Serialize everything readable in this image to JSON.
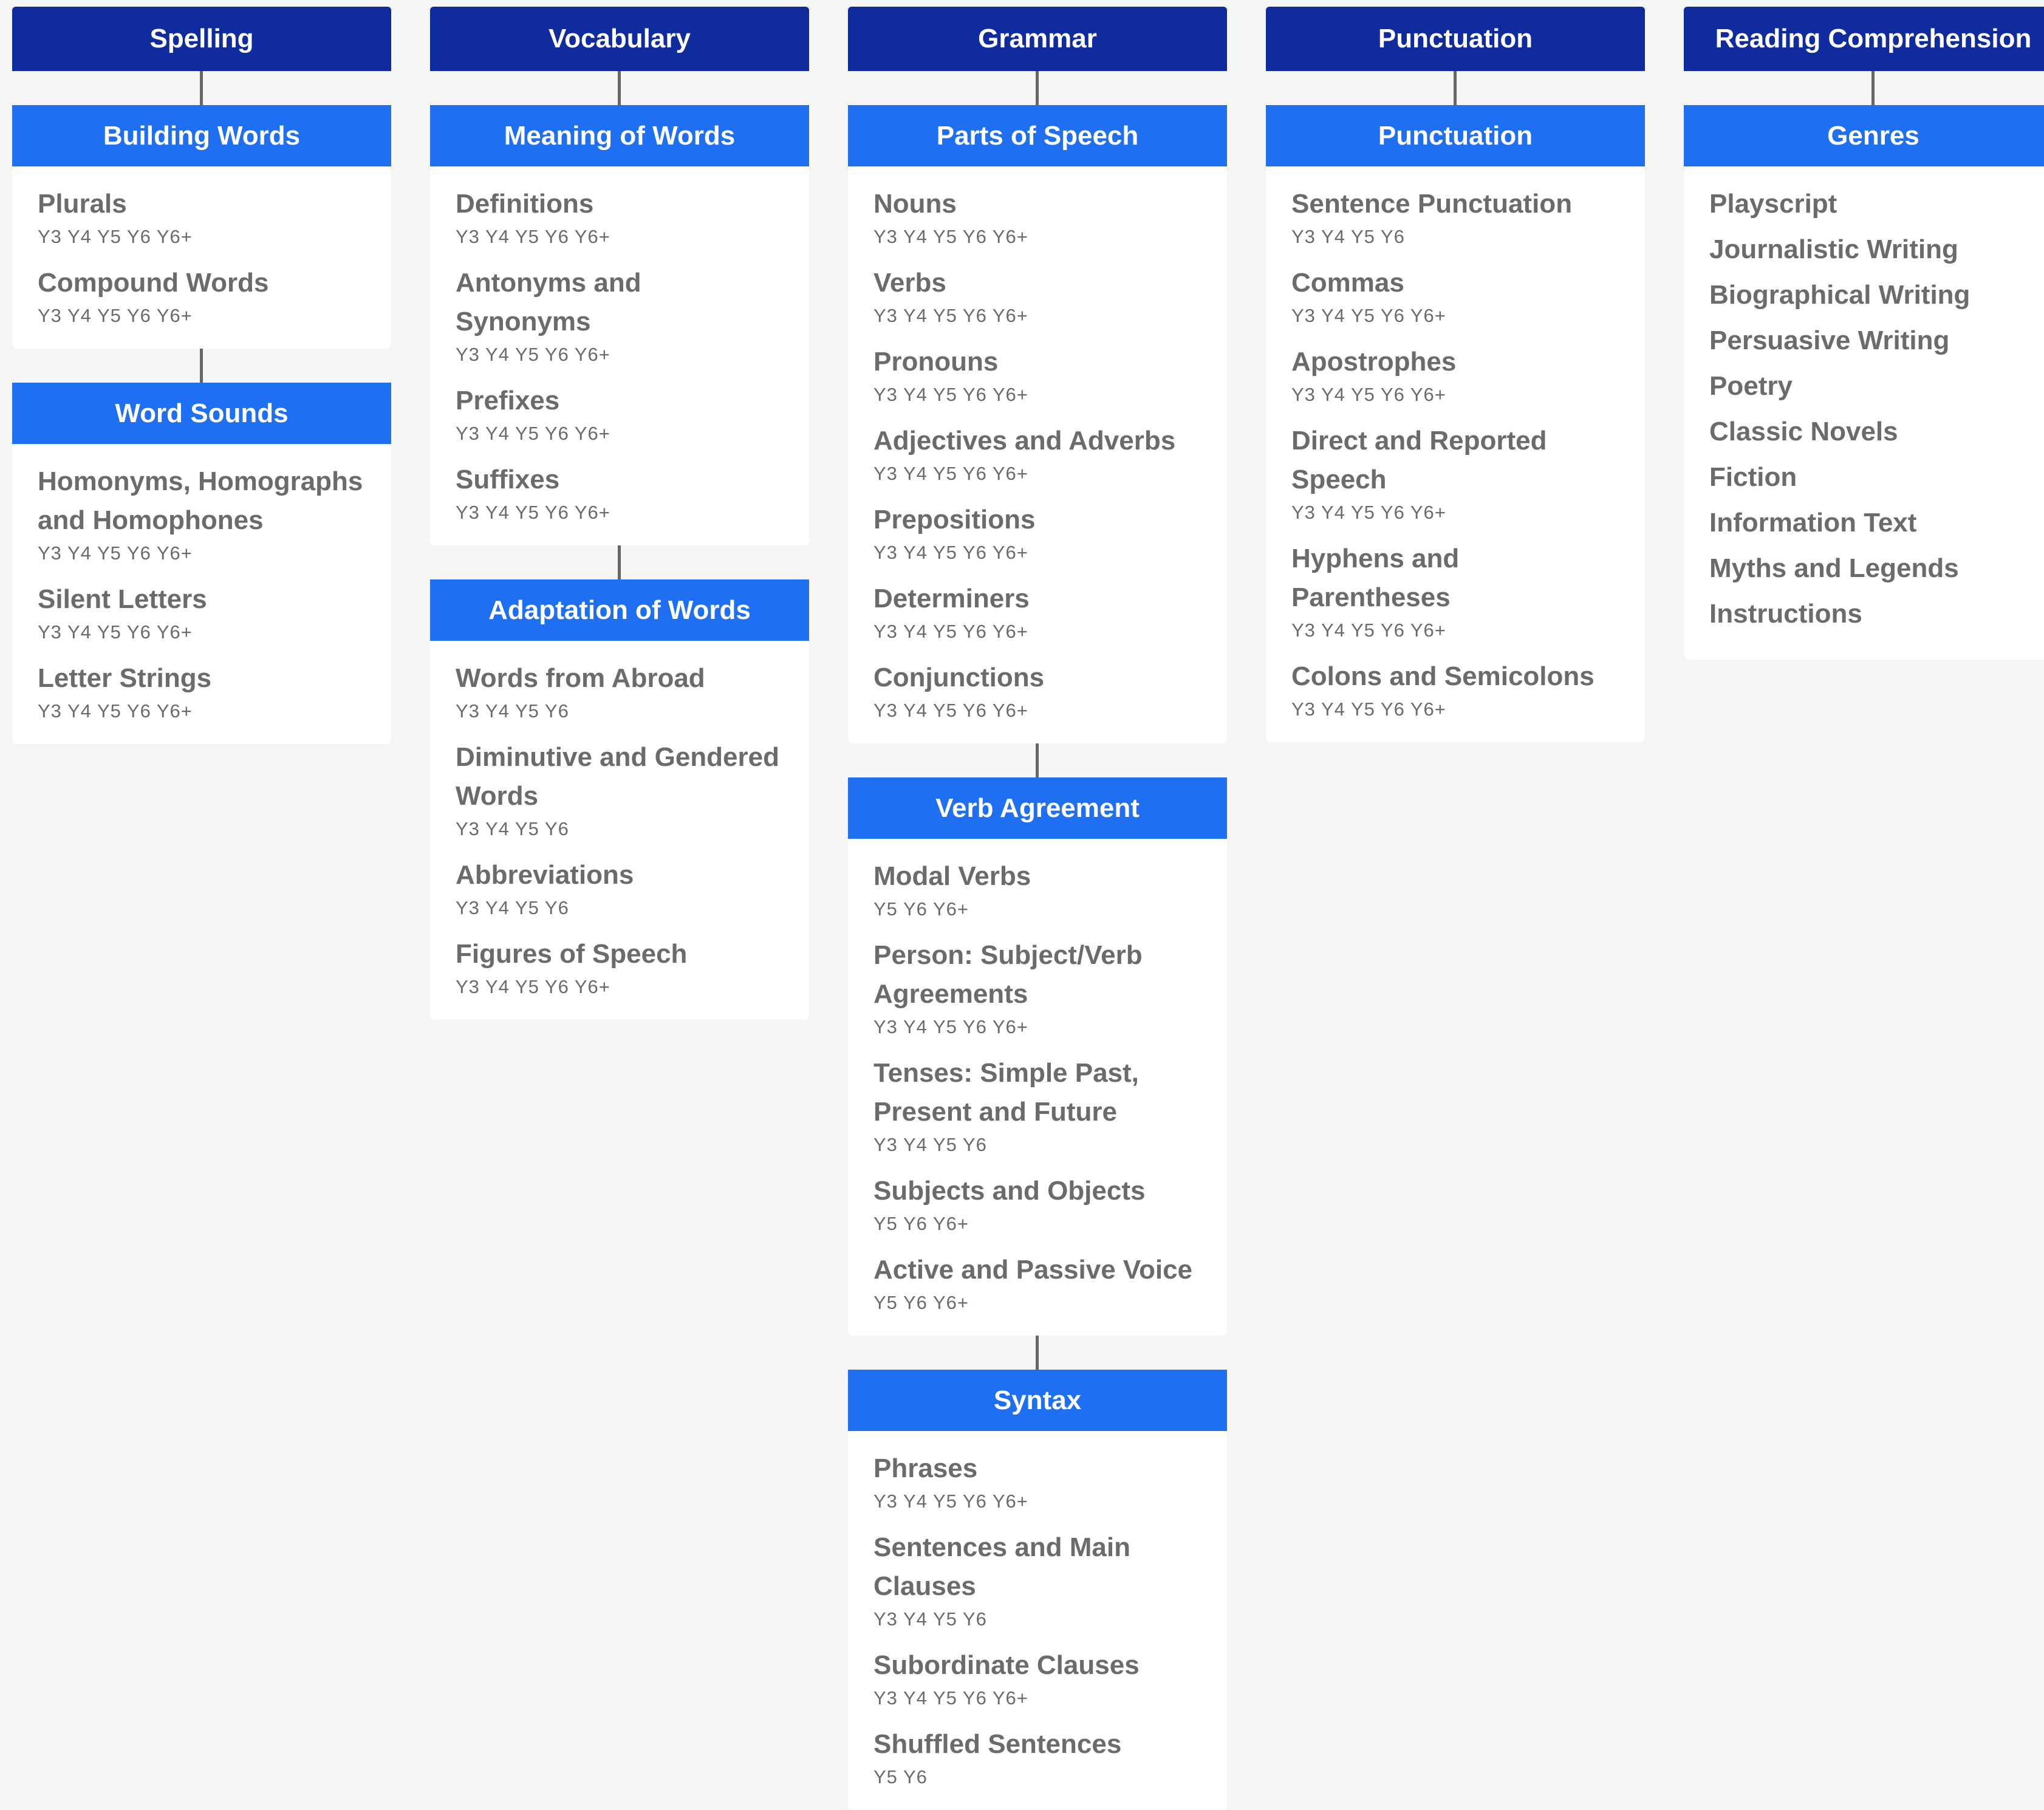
{
  "columns": [
    {
      "title": "Spelling",
      "groups": [
        {
          "title": "Building Words",
          "items": [
            {
              "name": "Plurals",
              "years": "Y3 Y4 Y5 Y6 Y6+"
            },
            {
              "name": "Compound Words",
              "years": "Y3 Y4 Y5 Y6 Y6+"
            }
          ]
        },
        {
          "title": "Word Sounds",
          "items": [
            {
              "name": "Homonyms, Homographs and Homophones",
              "years": "Y3 Y4 Y5 Y6 Y6+"
            },
            {
              "name": "Silent Letters",
              "years": "Y3 Y4 Y5 Y6 Y6+"
            },
            {
              "name": "Letter Strings",
              "years": "Y3 Y4 Y5 Y6 Y6+"
            }
          ]
        }
      ]
    },
    {
      "title": "Vocabulary",
      "groups": [
        {
          "title": "Meaning of Words",
          "items": [
            {
              "name": "Definitions",
              "years": "Y3 Y4 Y5 Y6 Y6+"
            },
            {
              "name": "Antonyms and Synonyms",
              "years": "Y3 Y4 Y5 Y6 Y6+"
            },
            {
              "name": "Prefixes",
              "years": "Y3 Y4 Y5 Y6 Y6+"
            },
            {
              "name": "Suffixes",
              "years": "Y3 Y4 Y5 Y6 Y6+"
            }
          ]
        },
        {
          "title": "Adaptation of Words",
          "items": [
            {
              "name": "Words from Abroad",
              "years": "Y3 Y4 Y5 Y6"
            },
            {
              "name": "Diminutive and Gendered Words",
              "years": "Y3 Y4 Y5 Y6"
            },
            {
              "name": "Abbreviations",
              "years": "Y3 Y4 Y5 Y6"
            },
            {
              "name": "Figures of Speech",
              "years": "Y3 Y4 Y5 Y6 Y6+"
            }
          ]
        }
      ]
    },
    {
      "title": "Grammar",
      "groups": [
        {
          "title": "Parts of Speech",
          "items": [
            {
              "name": "Nouns",
              "years": "Y3 Y4 Y5 Y6 Y6+"
            },
            {
              "name": "Verbs",
              "years": "Y3 Y4 Y5 Y6 Y6+"
            },
            {
              "name": "Pronouns",
              "years": "Y3 Y4 Y5 Y6 Y6+"
            },
            {
              "name": "Adjectives and Adverbs",
              "years": "Y3 Y4 Y5 Y6 Y6+"
            },
            {
              "name": "Prepositions",
              "years": "Y3 Y4 Y5 Y6 Y6+"
            },
            {
              "name": "Determiners",
              "years": "Y3 Y4 Y5 Y6 Y6+"
            },
            {
              "name": "Conjunctions",
              "years": "Y3 Y4 Y5 Y6 Y6+"
            }
          ]
        },
        {
          "title": "Verb Agreement",
          "items": [
            {
              "name": "Modal Verbs",
              "years": "Y5 Y6 Y6+"
            },
            {
              "name": "Person: Subject/Verb Agreements",
              "years": "Y3 Y4 Y5 Y6 Y6+"
            },
            {
              "name": "Tenses: Simple Past, Present and Future",
              "years": "Y3 Y4 Y5 Y6"
            },
            {
              "name": "Subjects and Objects",
              "years": "Y5 Y6 Y6+"
            },
            {
              "name": "Active and Passive Voice",
              "years": "Y5 Y6 Y6+"
            }
          ]
        },
        {
          "title": "Syntax",
          "items": [
            {
              "name": "Phrases",
              "years": "Y3 Y4 Y5 Y6 Y6+"
            },
            {
              "name": "Sentences and Main Clauses",
              "years": "Y3 Y4 Y5 Y6"
            },
            {
              "name": "Subordinate Clauses",
              "years": "Y3 Y4 Y5 Y6 Y6+"
            },
            {
              "name": "Shuffled Sentences",
              "years": "Y5 Y6"
            }
          ]
        }
      ]
    },
    {
      "title": "Punctuation",
      "groups": [
        {
          "title": "Punctuation",
          "items": [
            {
              "name": "Sentence Punctuation",
              "years": "Y3 Y4 Y5 Y6"
            },
            {
              "name": "Commas",
              "years": "Y3 Y4 Y5 Y6 Y6+"
            },
            {
              "name": "Apostrophes",
              "years": "Y3 Y4 Y5 Y6 Y6+"
            },
            {
              "name": "Direct and Reported Speech",
              "years": "Y3 Y4 Y5 Y6 Y6+"
            },
            {
              "name": "Hyphens and Parentheses",
              "years": "Y3 Y4 Y5 Y6 Y6+"
            },
            {
              "name": "Colons and Semicolons",
              "years": "Y3 Y4 Y5 Y6 Y6+"
            }
          ]
        }
      ]
    },
    {
      "title": "Reading Comprehension",
      "groups": [
        {
          "title": "Genres",
          "items": [
            {
              "name": "Playscript"
            },
            {
              "name": "Journalistic Writing"
            },
            {
              "name": "Biographical Writing"
            },
            {
              "name": "Persuasive Writing"
            },
            {
              "name": "Poetry"
            },
            {
              "name": "Classic Novels"
            },
            {
              "name": "Fiction"
            },
            {
              "name": "Information Text"
            },
            {
              "name": "Myths and Legends"
            },
            {
              "name": "Instructions"
            }
          ]
        }
      ]
    }
  ]
}
